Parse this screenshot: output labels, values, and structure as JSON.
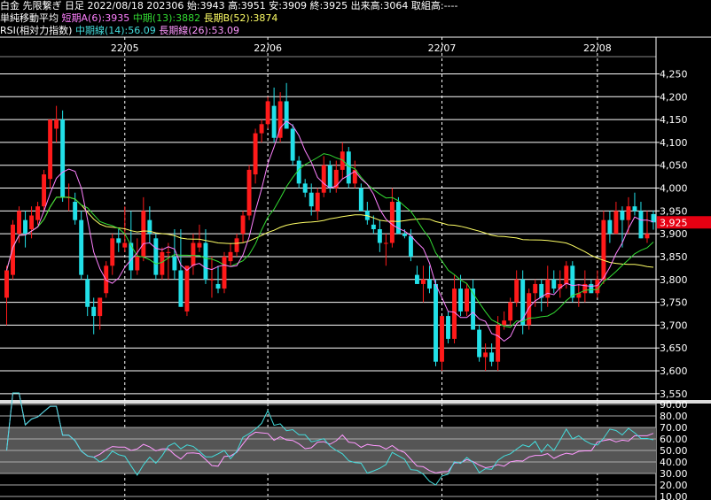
{
  "header": {
    "line1": "白金 先限繋ぎ 日足 2022/08/18 202306 始:3943 高:3951 安:3909 終:3925 出来高:3064 取組高:----",
    "ma_title": "単純移動平均",
    "ma_short": "短期A(6):3935",
    "ma_mid": "中期(13):3882",
    "ma_long": "長期B(52):3874",
    "rsi_title": "RSI(相対力指数)",
    "rsi_mid": "中期線(14):56.09",
    "rsi_long": "長期線(26):53.09"
  },
  "colors": {
    "background": "#000000",
    "up": "#ff1a1a",
    "down": "#22e0e8",
    "ma_short": "#ff80ff",
    "ma_mid": "#33dd33",
    "ma_long": "#ffff66",
    "rsi_mid": "#44dddd",
    "rsi_long": "#ff99ff",
    "grid": "#ffffff",
    "price_tag": "#e60012"
  },
  "chart_data": [
    {
      "type": "candlestick",
      "title": "",
      "x_tick_labels": [
        "22/05",
        "22/06",
        "22/07",
        "22/08"
      ],
      "x_tick_bar_index": [
        19,
        42,
        70,
        95
      ],
      "y_ticks": [
        3550,
        3600,
        3650,
        3700,
        3750,
        3800,
        3850,
        3900,
        3950,
        4000,
        4050,
        4100,
        4150,
        4200,
        4250
      ],
      "y_tick_labels": [
        "3,550",
        "3,600",
        "3,650",
        "3,700",
        "3,750",
        "3,800",
        "3,850",
        "3,900",
        "3,950",
        "4,000",
        "4,050",
        "4,100",
        "4,150",
        "4,200",
        "4,250"
      ],
      "ylim": [
        3540,
        4280
      ],
      "current_price_label": "3,925",
      "current_price": 3925,
      "ohlc": [
        [
          3760,
          3830,
          3700,
          3820
        ],
        [
          3810,
          3930,
          3800,
          3920
        ],
        [
          3900,
          3960,
          3880,
          3950
        ],
        [
          3930,
          3950,
          3870,
          3900
        ],
        [
          3910,
          3960,
          3890,
          3940
        ],
        [
          3930,
          3970,
          3920,
          3960
        ],
        [
          3960,
          4040,
          3950,
          4030
        ],
        [
          4020,
          4080,
          4000,
          4150
        ],
        [
          4130,
          4180,
          4100,
          4150
        ],
        [
          4150,
          4170,
          3970,
          3980
        ],
        [
          3980,
          4010,
          3950,
          3980
        ],
        [
          3970,
          3990,
          3920,
          3930
        ],
        [
          3930,
          3950,
          3800,
          3810
        ],
        [
          3800,
          3810,
          3720,
          3740
        ],
        [
          3740,
          3760,
          3680,
          3720
        ],
        [
          3720,
          3760,
          3690,
          3760
        ],
        [
          3770,
          3840,
          3760,
          3830
        ],
        [
          3830,
          3900,
          3810,
          3890
        ],
        [
          3890,
          3910,
          3860,
          3880
        ],
        [
          3870,
          3960,
          3860,
          3880
        ],
        [
          3880,
          3950,
          3800,
          3820
        ],
        [
          3820,
          3890,
          3810,
          3850
        ],
        [
          3850,
          3980,
          3840,
          3950
        ],
        [
          3930,
          3960,
          3880,
          3900
        ],
        [
          3890,
          3900,
          3800,
          3810
        ],
        [
          3810,
          3870,
          3800,
          3860
        ],
        [
          3860,
          3880,
          3800,
          3860
        ],
        [
          3850,
          3910,
          3800,
          3820
        ],
        [
          3820,
          3910,
          3740,
          3740
        ],
        [
          3730,
          3820,
          3720,
          3830
        ],
        [
          3830,
          3900,
          3810,
          3880
        ],
        [
          3870,
          3920,
          3860,
          3880
        ],
        [
          3880,
          3910,
          3790,
          3800
        ],
        [
          3800,
          3850,
          3760,
          3800
        ],
        [
          3790,
          3830,
          3770,
          3780
        ],
        [
          3780,
          3860,
          3770,
          3850
        ],
        [
          3840,
          3880,
          3830,
          3860
        ],
        [
          3860,
          3900,
          3850,
          3890
        ],
        [
          3900,
          3950,
          3880,
          3940
        ],
        [
          3940,
          4050,
          3930,
          4040
        ],
        [
          4030,
          4130,
          4010,
          4120
        ],
        [
          4120,
          4150,
          4100,
          4140
        ],
        [
          4140,
          4200,
          4130,
          4190
        ],
        [
          4180,
          4220,
          4100,
          4110
        ],
        [
          4110,
          4210,
          4100,
          4190
        ],
        [
          4190,
          4230,
          4130,
          4130
        ],
        [
          4130,
          4140,
          4050,
          4060
        ],
        [
          4060,
          4070,
          4000,
          4010
        ],
        [
          4010,
          4020,
          3980,
          3990
        ],
        [
          3990,
          4010,
          3940,
          3960
        ],
        [
          3950,
          4000,
          3930,
          3990
        ],
        [
          3990,
          4070,
          3980,
          4050
        ],
        [
          4050,
          4060,
          3990,
          4000
        ],
        [
          4000,
          4060,
          3990,
          4040
        ],
        [
          4040,
          4100,
          4020,
          4080
        ],
        [
          4080,
          4090,
          4000,
          4010
        ],
        [
          4010,
          4060,
          4000,
          4040
        ],
        [
          4000,
          4010,
          3950,
          3950
        ],
        [
          3950,
          3970,
          3920,
          3930
        ],
        [
          3920,
          3940,
          3900,
          3910
        ],
        [
          3910,
          3930,
          3860,
          3880
        ],
        [
          3880,
          3900,
          3830,
          3880
        ],
        [
          3880,
          4000,
          3870,
          3970
        ],
        [
          3970,
          3980,
          3900,
          3900
        ],
        [
          3900,
          3910,
          3890,
          3895
        ],
        [
          3895,
          3910,
          3840,
          3850
        ],
        [
          3810,
          3830,
          3790,
          3790
        ],
        [
          3790,
          3830,
          3750,
          3800
        ],
        [
          3800,
          3830,
          3770,
          3780
        ],
        [
          3790,
          3800,
          3610,
          3620
        ],
        [
          3620,
          3720,
          3600,
          3720
        ],
        [
          3720,
          3730,
          3660,
          3670
        ],
        [
          3670,
          3810,
          3660,
          3780
        ],
        [
          3780,
          3810,
          3720,
          3730
        ],
        [
          3730,
          3790,
          3720,
          3780
        ],
        [
          3780,
          3800,
          3690,
          3690
        ],
        [
          3690,
          3700,
          3620,
          3630
        ],
        [
          3630,
          3660,
          3600,
          3640
        ],
        [
          3640,
          3660,
          3610,
          3620
        ],
        [
          3620,
          3720,
          3600,
          3700
        ],
        [
          3700,
          3730,
          3690,
          3710
        ],
        [
          3710,
          3760,
          3700,
          3750
        ],
        [
          3750,
          3820,
          3740,
          3800
        ],
        [
          3800,
          3820,
          3680,
          3700
        ],
        [
          3700,
          3780,
          3690,
          3770
        ],
        [
          3770,
          3800,
          3740,
          3790
        ],
        [
          3790,
          3800,
          3730,
          3760
        ],
        [
          3760,
          3830,
          3740,
          3800
        ],
        [
          3800,
          3820,
          3770,
          3780
        ],
        [
          3780,
          3820,
          3760,
          3790
        ],
        [
          3790,
          3840,
          3780,
          3830
        ],
        [
          3830,
          3840,
          3750,
          3760
        ],
        [
          3760,
          3790,
          3740,
          3770
        ],
        [
          3770,
          3820,
          3750,
          3790
        ],
        [
          3790,
          3800,
          3770,
          3770
        ],
        [
          3770,
          3820,
          3760,
          3800
        ],
        [
          3800,
          3950,
          3790,
          3930
        ],
        [
          3930,
          3950,
          3880,
          3900
        ],
        [
          3900,
          3970,
          3900,
          3950
        ],
        [
          3950,
          3960,
          3870,
          3930
        ],
        [
          3930,
          3980,
          3900,
          3960
        ],
        [
          3960,
          3990,
          3940,
          3950
        ],
        [
          3950,
          3970,
          3890,
          3890
        ],
        [
          3890,
          3950,
          3880,
          3900
        ],
        [
          3943,
          3951,
          3909,
          3925
        ]
      ]
    },
    {
      "type": "line",
      "title": "",
      "y_ticks": [
        10,
        20,
        30,
        40,
        50,
        60,
        70,
        80,
        90
      ],
      "y_tick_labels": [
        "10.00",
        "20.00",
        "30.00",
        "40.00",
        "50.00",
        "60.00",
        "70.00",
        "80.00",
        "90.00"
      ],
      "ylim": [
        10,
        90
      ]
    }
  ]
}
